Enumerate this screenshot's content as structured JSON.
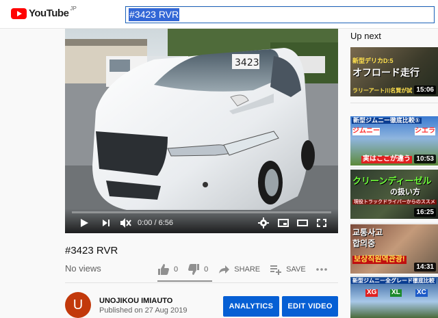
{
  "header": {
    "logo_text": "YouTube",
    "logo_region": "JP",
    "search_value": "#3423 RVR"
  },
  "player": {
    "time_display": "0:00 / 6:56",
    "progress_fraction": 0,
    "plate_text": "3423"
  },
  "video": {
    "title": "#3423 RVR",
    "views": "No views",
    "likes": "0",
    "dislikes": "0",
    "share_label": "SHARE",
    "save_label": "SAVE"
  },
  "channel": {
    "avatar_letter": "U",
    "name": "UNOJIKOU IMIAUTO",
    "published": "Published on 27 Aug 2019",
    "analytics_label": "ANALYTICS",
    "edit_label": "EDIT VIDEO"
  },
  "sidebar": {
    "up_next_label": "Up next",
    "items": [
      {
        "caption_1": "新型デリカD:5",
        "caption_2": "オフロード走行",
        "caption_3": "ラリーアート川名賢が試",
        "duration": "15:06"
      },
      {
        "caption_1": "新型ジムニー徹底比較①",
        "caption_2": "ジムニー",
        "caption_3": "シエラ",
        "caption_4": "実はここが違う",
        "duration": "10:53"
      },
      {
        "caption_1": "クリーンディーゼル",
        "caption_2": "の扱い方",
        "caption_3": "現役トラックドライバーからのススメ",
        "duration": "16:25"
      },
      {
        "caption_1": "교통사고",
        "caption_2": "합의중",
        "caption_3": "보상직원역관광!",
        "duration": "14:31"
      },
      {
        "caption_1": "新型ジムニー全グレード徹底比較",
        "caption_2": "XG",
        "caption_3": "XL",
        "caption_4": "XC"
      }
    ]
  }
}
